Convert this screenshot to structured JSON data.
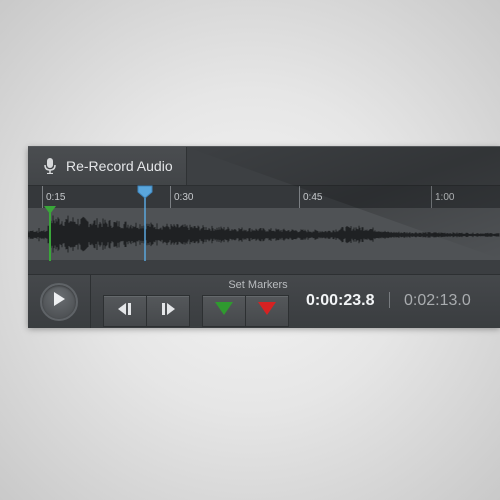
{
  "title": "Re-Record Audio",
  "ruler": {
    "ticks": [
      {
        "label": "0:15",
        "major": true
      },
      {
        "label": "0:30",
        "major": true
      },
      {
        "label": "0:45",
        "major": true
      },
      {
        "label": "1:00",
        "major": true
      }
    ]
  },
  "playhead_time": "0:23.8",
  "controls": {
    "set_markers_label": "Set Markers",
    "current_time": "0:00:23.8",
    "total_time": "0:02:13.0"
  },
  "colors": {
    "playhead": "#5aa6dc",
    "start_marker": "#3aa63a",
    "end_marker": "#d62222",
    "panel_bg": "#3b3e41"
  },
  "icons": [
    "mic-icon",
    "play-icon",
    "step-back-icon",
    "step-forward-icon",
    "start-marker-icon",
    "end-marker-icon"
  ]
}
